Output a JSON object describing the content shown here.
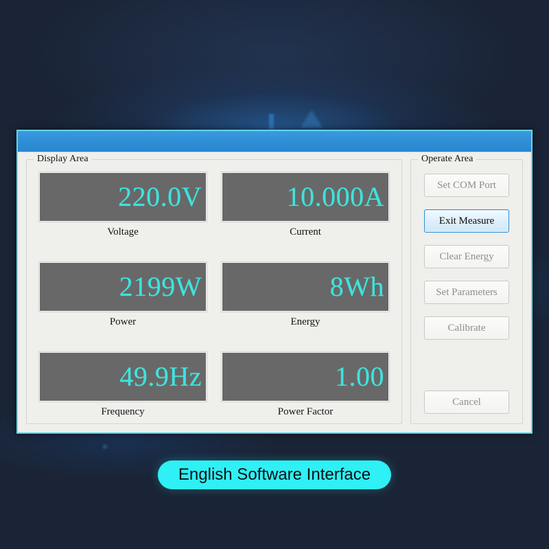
{
  "window": {
    "title_bar_text": "",
    "title_bar_color": "#2e8ed6",
    "border_color": "#63d6ea",
    "body_color": "#efefec"
  },
  "display_area": {
    "legend": "Display Area",
    "readout_bg": "#686868",
    "readout_text_color": "#3fe3dd",
    "rows": [
      [
        {
          "value": "220.0V",
          "label": "Voltage"
        },
        {
          "value": "10.000A",
          "label": "Current"
        }
      ],
      [
        {
          "value": "2199W",
          "label": "Power"
        },
        {
          "value": "8Wh",
          "label": "Energy"
        }
      ],
      [
        {
          "value": "49.9Hz",
          "label": "Frequency"
        },
        {
          "value": "1.00",
          "label": "Power Factor"
        }
      ]
    ]
  },
  "operate_area": {
    "legend": "Operate Area",
    "buttons": [
      {
        "label": "Set COM Port",
        "state": "disabled"
      },
      {
        "label": "Exit Measure",
        "state": "focused"
      },
      {
        "label": "Clear Energy",
        "state": "disabled"
      },
      {
        "label": "Set Parameters",
        "state": "disabled"
      },
      {
        "label": "Calibrate",
        "state": "disabled"
      }
    ],
    "cancel_button": {
      "label": "Cancel",
      "state": "disabled"
    }
  },
  "caption": {
    "text": "English Software Interface",
    "background": "#2ff0f4",
    "text_color": "#0d1115"
  }
}
